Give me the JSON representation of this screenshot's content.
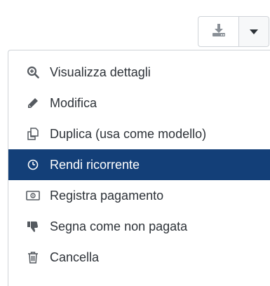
{
  "toolbar": {
    "download_icon": "download-icon",
    "caret_icon": "caret-down-icon"
  },
  "menu": {
    "items": [
      {
        "label": "Visualizza dettagli",
        "icon": "zoom-in-icon"
      },
      {
        "label": "Modifica",
        "icon": "pencil-icon"
      },
      {
        "label": "Duplica (usa come modello)",
        "icon": "copy-icon"
      },
      {
        "label": "Rendi ricorrente",
        "icon": "clock-icon",
        "active": true
      },
      {
        "label": "Registra pagamento",
        "icon": "money-icon"
      },
      {
        "label": "Segna come non pagata",
        "icon": "thumbs-down-icon"
      },
      {
        "label": "Cancella",
        "icon": "trash-icon"
      }
    ]
  },
  "colors": {
    "accent": "#133f78",
    "text": "#2d3238",
    "icon": "#555a60",
    "border": "#cfd3d8"
  }
}
